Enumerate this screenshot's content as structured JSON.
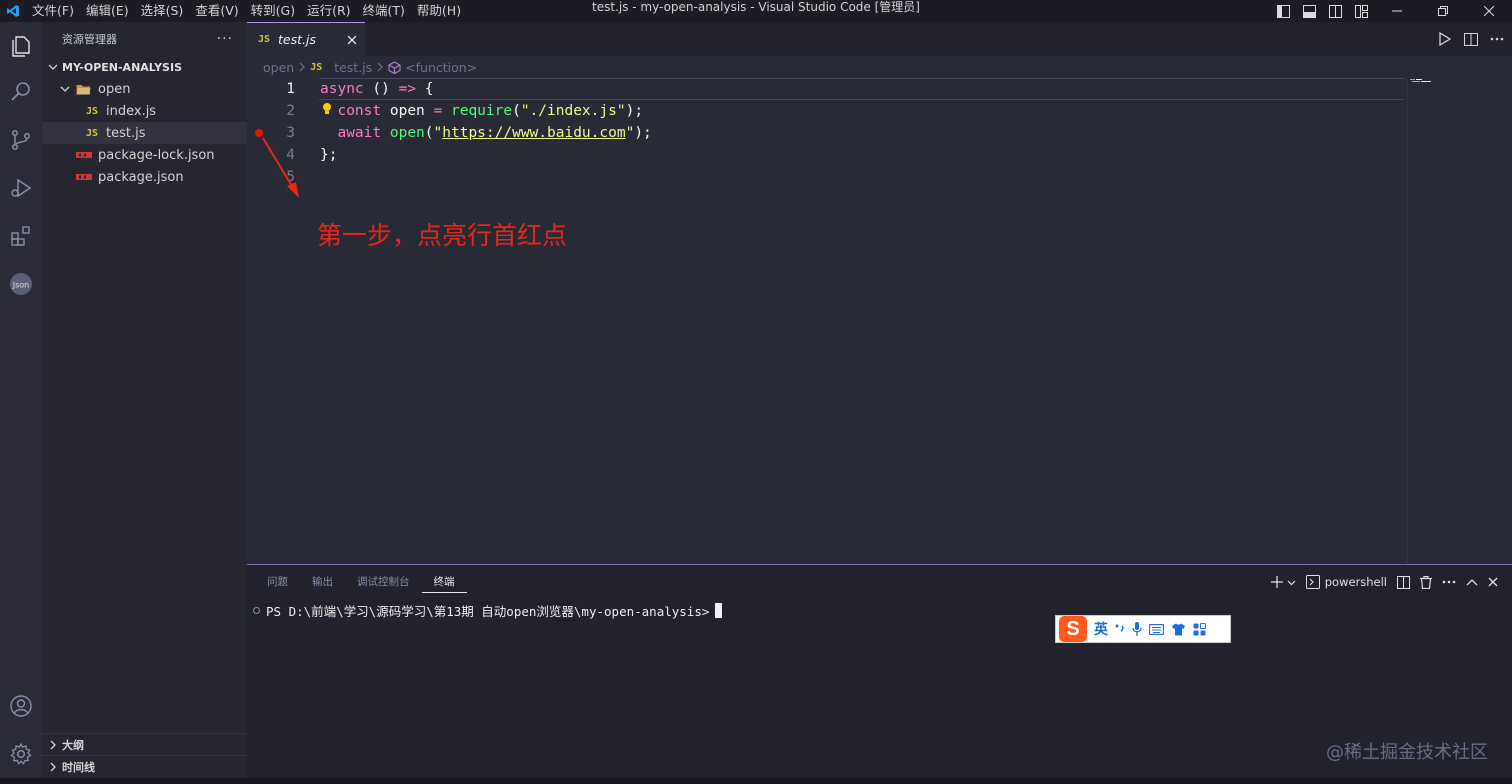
{
  "titlebar": {
    "menu": [
      "文件(F)",
      "编辑(E)",
      "选择(S)",
      "查看(V)",
      "转到(G)",
      "运行(R)",
      "终端(T)",
      "帮助(H)"
    ],
    "title": "test.js - my-open-analysis - Visual Studio Code [管理员]"
  },
  "sidebar": {
    "header": "资源管理器",
    "more": "···",
    "project": "MY-OPEN-ANALYSIS",
    "folder": "open",
    "files": [
      {
        "icon": "JS",
        "name": "index.js"
      },
      {
        "icon": "JS",
        "name": "test.js"
      }
    ],
    "root_files": [
      "package-lock.json",
      "package.json"
    ],
    "outline": "大纲",
    "timeline": "时间线"
  },
  "editor": {
    "tab": {
      "icon": "JS",
      "label": "test.js"
    },
    "breadcrumb": {
      "folder": "open",
      "icon": "JS",
      "file": "test.js",
      "symbol": "<function>"
    },
    "line_numbers": [
      "1",
      "2",
      "3",
      "4",
      "5"
    ],
    "annotation": "第一步，点亮行首红点"
  },
  "panel": {
    "tabs": [
      "问题",
      "输出",
      "调试控制台",
      "终端"
    ],
    "shell": "powershell",
    "prompt": "PS D:\\前端\\学习\\源码学习\\第13期 自动open浏览器\\my-open-analysis>",
    "ime_label": "英"
  },
  "watermark": "@稀土掘金技术社区",
  "colors": {
    "accent": "#bd93f9",
    "breakpoint": "#e51400",
    "annotation": "#e8261c"
  }
}
